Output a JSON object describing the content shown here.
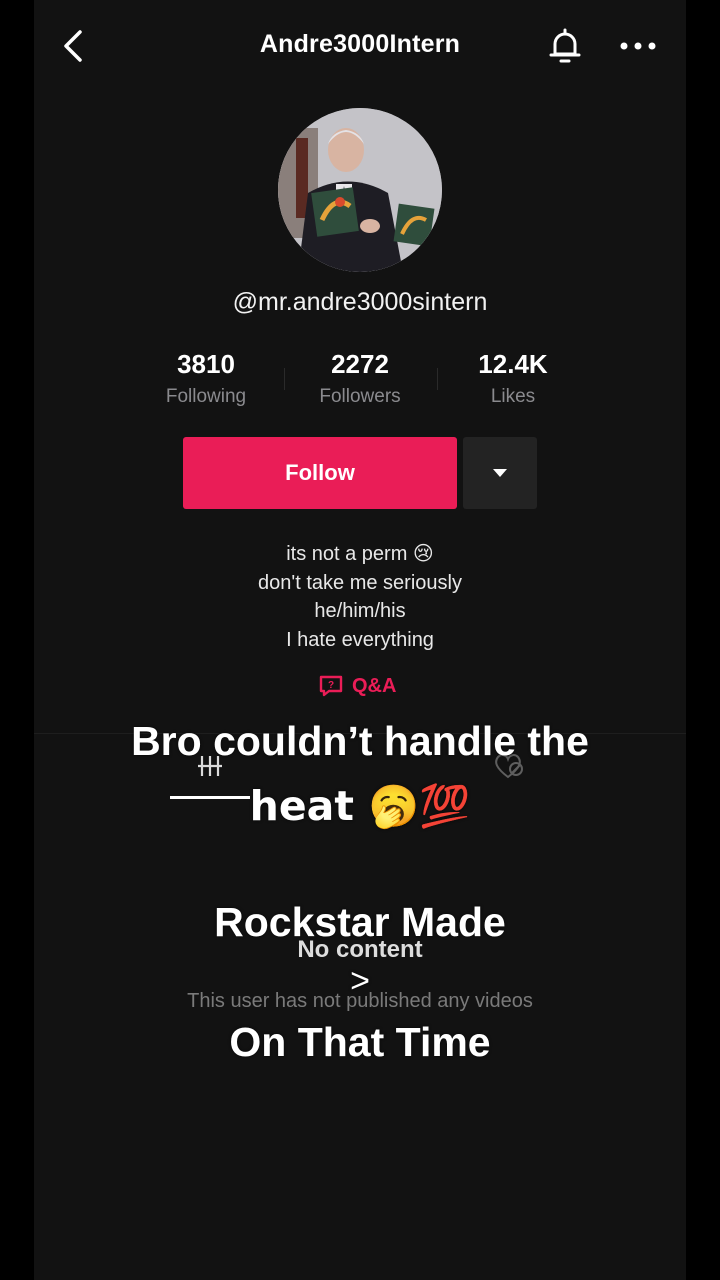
{
  "header": {
    "title": "Andre3000Intern",
    "back_icon": "chevron-left-icon",
    "bell_icon": "bell-icon",
    "more_icon": "more-dots-icon"
  },
  "profile": {
    "handle": "@mr.andre3000sintern",
    "stats": [
      {
        "value": "3810",
        "label": "Following"
      },
      {
        "value": "2272",
        "label": "Followers"
      },
      {
        "value": "12.4K",
        "label": "Likes"
      }
    ],
    "follow_label": "Follow",
    "bio_lines": [
      "its not a perm 😢",
      "don't take me seriously",
      "he/him/his",
      "I hate everything"
    ],
    "qa_label": "Q&A"
  },
  "empty_state": {
    "title": "No content",
    "subtitle": "This user has not published any videos"
  },
  "caption": {
    "line1": "Bro couldn’t handle the",
    "line2": "heat 🥱💯",
    "line3": "Rockstar Made",
    "line4": ">",
    "line5": "On That Time"
  },
  "colors": {
    "accent": "#ea1d57",
    "background": "#121212",
    "muted": "#8a8a8e"
  }
}
